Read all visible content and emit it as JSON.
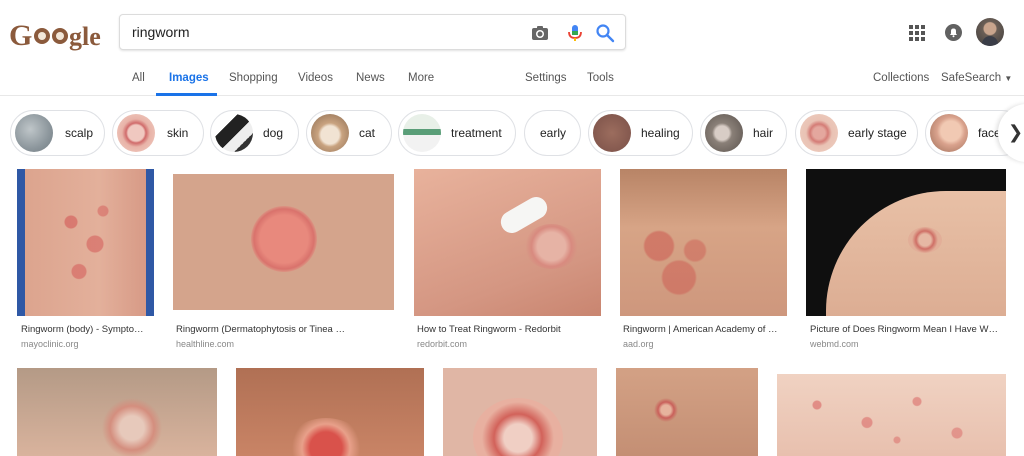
{
  "header": {
    "logo_text": "Google",
    "query": "ringworm",
    "icons": [
      "camera-icon",
      "microphone-icon",
      "search-icon",
      "apps-icon",
      "notifications-icon"
    ]
  },
  "tabs": {
    "all": "All",
    "images": "Images",
    "shopping": "Shopping",
    "videos": "Videos",
    "news": "News",
    "more": "More",
    "settings": "Settings",
    "tools": "Tools",
    "collections": "Collections",
    "safesearch": "SafeSearch"
  },
  "chips": [
    {
      "label": "scalp"
    },
    {
      "label": "skin"
    },
    {
      "label": "dog"
    },
    {
      "label": "cat"
    },
    {
      "label": "treatment"
    },
    {
      "label": "early"
    },
    {
      "label": "healing"
    },
    {
      "label": "hair"
    },
    {
      "label": "early stage"
    },
    {
      "label": "face"
    }
  ],
  "results": [
    {
      "caption": "Ringworm (body) - Sympto…",
      "source": "mayoclinic.org"
    },
    {
      "caption": "Ringworm (Dermatophytosis or Tinea …",
      "source": "healthline.com"
    },
    {
      "caption": "How to Treat Ringworm - Redorbit",
      "source": "redorbit.com"
    },
    {
      "caption": "Ringworm | American Academy of …",
      "source": "aad.org"
    },
    {
      "caption": "Picture of Does Ringworm Mean I Have W…",
      "source": "webmd.com"
    }
  ],
  "colors": {
    "accent": "#1a73e8",
    "skin": "#d9a28d",
    "lesion": "#d8706a"
  }
}
